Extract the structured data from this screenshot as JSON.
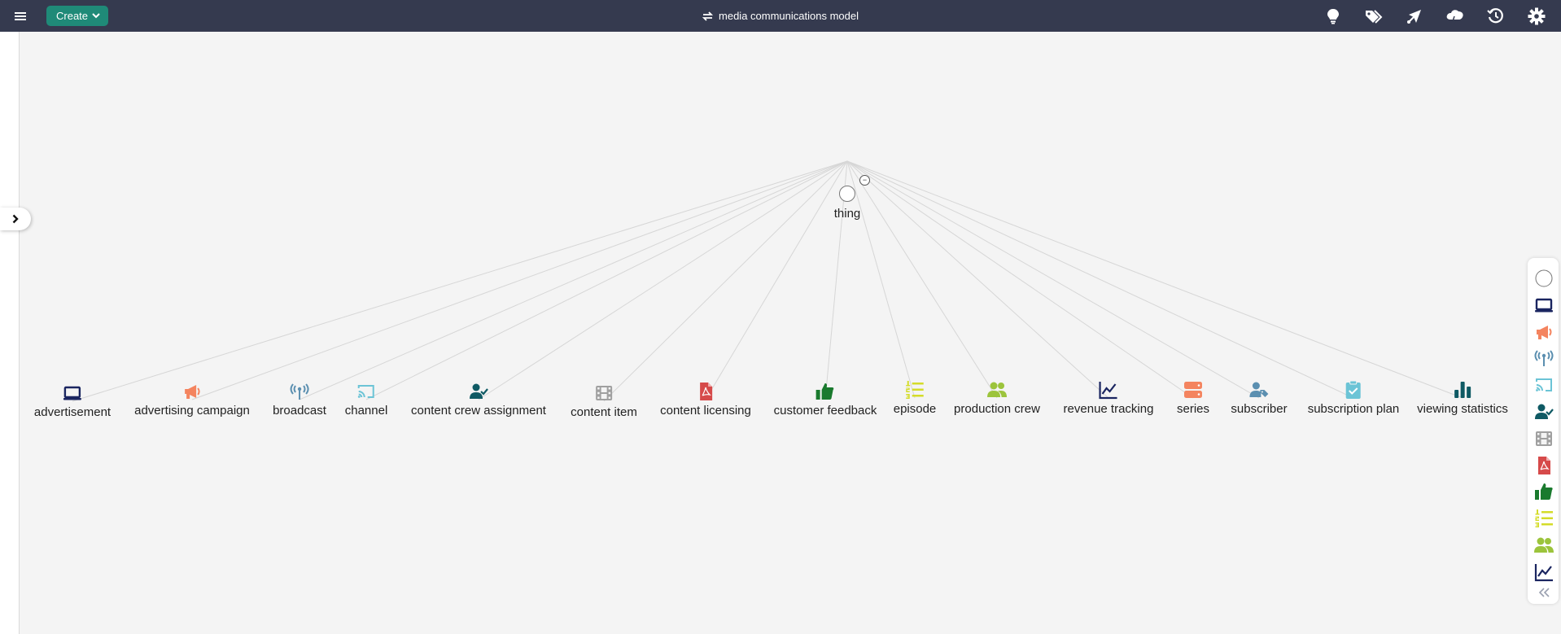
{
  "header": {
    "create_label": "Create",
    "title": "media communications model",
    "tools": [
      "lightbulb-icon",
      "tags-icon",
      "share-graph-icon",
      "cloud-sync-icon",
      "history-icon",
      "gear-icon"
    ]
  },
  "graph": {
    "root": {
      "label": "thing"
    },
    "nodes": [
      {
        "label": "advertisement",
        "icon": "laptop-icon",
        "color": "#1a2560"
      },
      {
        "label": "advertising campaign",
        "icon": "megaphone-icon",
        "color": "#f4845f"
      },
      {
        "label": "broadcast",
        "icon": "broadcast-tower-icon",
        "color": "#5b8fb0"
      },
      {
        "label": "channel",
        "icon": "cast-icon",
        "color": "#6cc4d6"
      },
      {
        "label": "content crew assignment",
        "icon": "user-check-icon",
        "color": "#0f5a64"
      },
      {
        "label": "content item",
        "icon": "film-icon",
        "color": "#a0a0a0"
      },
      {
        "label": "content licensing",
        "icon": "pdf-file-icon",
        "color": "#d64a4a"
      },
      {
        "label": "customer feedback",
        "icon": "thumbs-up-icon",
        "color": "#1a7a2e"
      },
      {
        "label": "episode",
        "icon": "numbered-list-icon",
        "color": "#d4dc2a"
      },
      {
        "label": "production crew",
        "icon": "users-icon",
        "color": "#9cc43c"
      },
      {
        "label": "revenue tracking",
        "icon": "line-chart-icon",
        "color": "#1a2560"
      },
      {
        "label": "series",
        "icon": "server-icon",
        "color": "#f4845f"
      },
      {
        "label": "subscriber",
        "icon": "user-tag-icon",
        "color": "#5b8fb0"
      },
      {
        "label": "subscription plan",
        "icon": "clipboard-check-icon",
        "color": "#6cc4d6"
      },
      {
        "label": "viewing statistics",
        "icon": "bar-chart-icon",
        "color": "#0f5a64"
      }
    ]
  },
  "legend": {
    "items": [
      "circle-icon",
      "laptop-icon",
      "megaphone-icon",
      "broadcast-tower-icon",
      "cast-icon",
      "user-check-icon",
      "film-icon",
      "pdf-file-icon",
      "thumbs-up-icon",
      "numbered-list-icon",
      "users-icon",
      "line-chart-icon"
    ],
    "collapse_icon": "double-chevron-left-icon"
  }
}
